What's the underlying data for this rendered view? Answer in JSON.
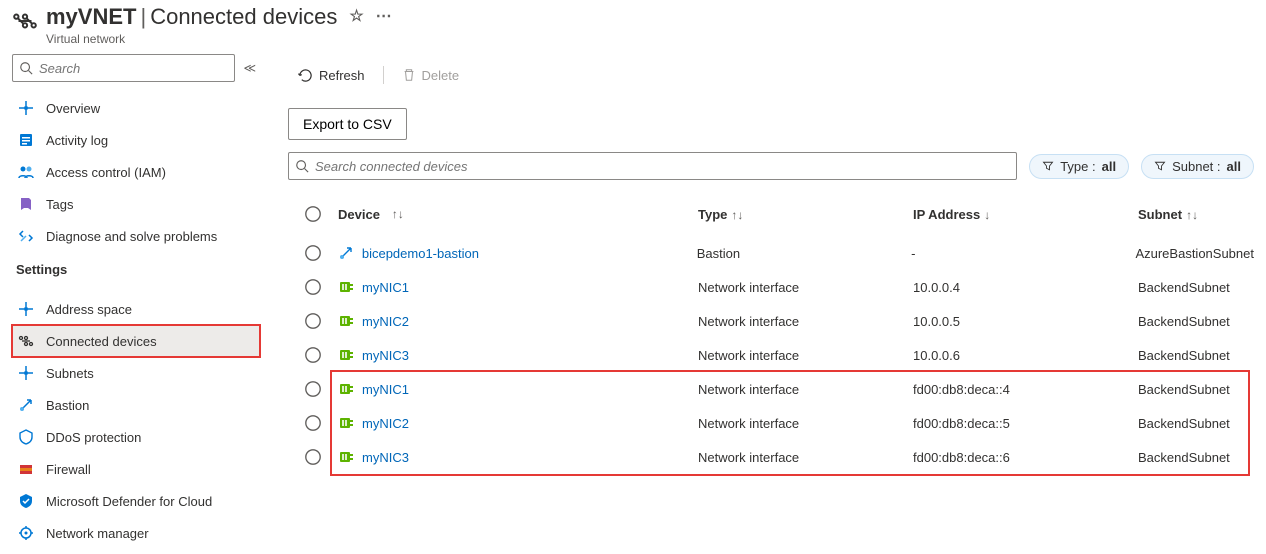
{
  "header": {
    "resource": "myVNET",
    "section": "Connected devices",
    "subtitle": "Virtual network"
  },
  "sidebar": {
    "search_placeholder": "Search",
    "items": [
      {
        "label": "Overview"
      },
      {
        "label": "Activity log"
      },
      {
        "label": "Access control (IAM)"
      },
      {
        "label": "Tags"
      },
      {
        "label": "Diagnose and solve problems"
      }
    ],
    "settings_header": "Settings",
    "settings_items": [
      {
        "label": "Address space"
      },
      {
        "label": "Connected devices",
        "selected": true
      },
      {
        "label": "Subnets"
      },
      {
        "label": "Bastion"
      },
      {
        "label": "DDoS protection"
      },
      {
        "label": "Firewall"
      },
      {
        "label": "Microsoft Defender for Cloud"
      },
      {
        "label": "Network manager"
      }
    ]
  },
  "toolbar": {
    "refresh": "Refresh",
    "delete": "Delete",
    "export": "Export to CSV",
    "search_placeholder": "Search connected devices",
    "filters": {
      "type_label": "Type :",
      "type_value": "all",
      "subnet_label": "Subnet :",
      "subnet_value": "all"
    }
  },
  "columns": {
    "device": "Device",
    "type": "Type",
    "ip": "IP Address",
    "subnet": "Subnet"
  },
  "rows": [
    {
      "device": "bicepdemo1-bastion",
      "icon": "bastion",
      "type": "Bastion",
      "ip": "-",
      "subnet": "AzureBastionSubnet"
    },
    {
      "device": "myNIC1",
      "icon": "nic",
      "type": "Network interface",
      "ip": "10.0.0.4",
      "subnet": "BackendSubnet"
    },
    {
      "device": "myNIC2",
      "icon": "nic",
      "type": "Network interface",
      "ip": "10.0.0.5",
      "subnet": "BackendSubnet"
    },
    {
      "device": "myNIC3",
      "icon": "nic",
      "type": "Network interface",
      "ip": "10.0.0.6",
      "subnet": "BackendSubnet"
    },
    {
      "device": "myNIC1",
      "icon": "nic",
      "type": "Network interface",
      "ip": "fd00:db8:deca::4",
      "subnet": "BackendSubnet",
      "hl": true
    },
    {
      "device": "myNIC2",
      "icon": "nic",
      "type": "Network interface",
      "ip": "fd00:db8:deca::5",
      "subnet": "BackendSubnet",
      "hl": true
    },
    {
      "device": "myNIC3",
      "icon": "nic",
      "type": "Network interface",
      "ip": "fd00:db8:deca::6",
      "subnet": "BackendSubnet",
      "hl": true
    }
  ]
}
